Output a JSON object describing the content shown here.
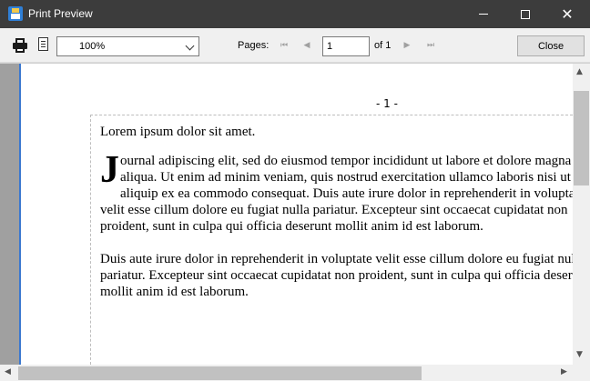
{
  "window": {
    "title": "Print Preview",
    "minimize_glyph": "",
    "close_glyph": "✕"
  },
  "toolbar": {
    "print_icon": "printer-icon",
    "page_setup_icon": "page-icon",
    "zoom": {
      "value": "100%"
    },
    "pages_label": "Pages:",
    "nav": {
      "first": "⏮",
      "prev": "◀",
      "next": "▶",
      "last": "⏭"
    },
    "current_page": "1",
    "of_label": "of 1",
    "close_label": "Close"
  },
  "preview": {
    "page_number": "- 1 -",
    "heading": "Lorem ipsum dolor sit amet.",
    "drop_cap": "J",
    "para1_lines": [
      "ournal adipiscing elit, sed do eiusmod tempor incididunt ut labore et dolore magna",
      "aliqua. Ut enim ad minim veniam, quis nostrud exercitation ullamco laboris nisi ut",
      "aliquip ex ea commodo consequat. Duis aute irure dolor in reprehenderit in voluptate",
      "velit esse cillum dolore eu fugiat nulla pariatur. Excepteur sint occaecat cupidatat non",
      "proident, sunt in culpa qui officia deserunt mollit anim id est laborum."
    ],
    "para2_lines": [
      "Duis aute irure dolor in reprehenderit in voluptate velit esse cillum dolore eu fugiat nulla",
      "pariatur. Excepteur sint occaecat cupidatat non proident, sunt in culpa qui officia deserunt",
      "mollit anim id est laborum."
    ]
  },
  "scrollbars": {
    "up": "▲",
    "down": "▼",
    "left": "◀",
    "right": "▶"
  },
  "colors": {
    "titlebar": "#3c3c3c",
    "accent": "#3a78d0",
    "gutter": "#a0a0a0"
  }
}
